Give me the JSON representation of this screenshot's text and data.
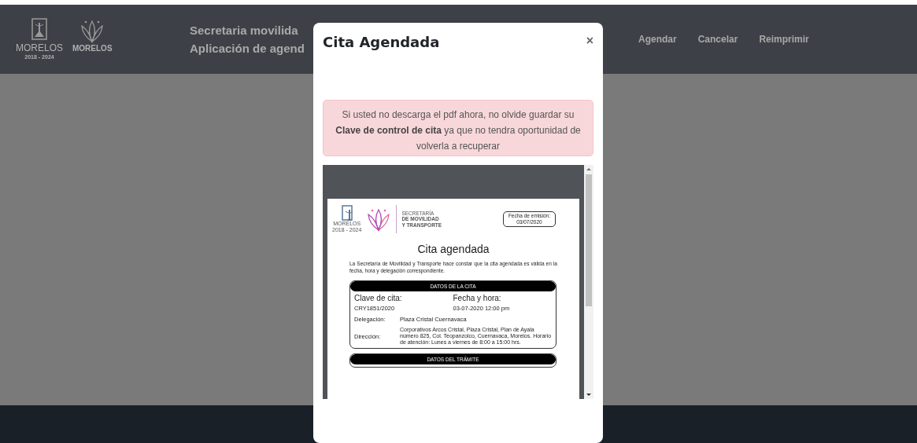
{
  "header": {
    "logo": {
      "name": "MORELOS",
      "years": "2018 - 2024"
    },
    "brand_logo": {
      "name": "MORELOS"
    },
    "title": "Secretaria movilida",
    "subtitle": "Aplicación de agend",
    "nav": [
      {
        "label": "Agendar"
      },
      {
        "label": "Cancelar"
      },
      {
        "label": "Reimprimir"
      }
    ]
  },
  "modal": {
    "title": "Cita Agendada",
    "close": "×",
    "alert": "Si usted no descarga el pdf ahora, no olvide guardar su **Clave de control de cita** ya que no tendra oportunidad de volverla a recuperar",
    "pdf": {
      "logo": {
        "name": "MORELOS",
        "years": "2018 - 2024"
      },
      "agency": [
        "SECRETARÍA",
        "DE MOVILIDAD",
        "Y TRANSPORTE"
      ],
      "issue_label": "Fecha de emisión:",
      "issue_date": "03/07/2020",
      "title": "Cita agendada",
      "intro": "La Secretaría de Movilidad y Transporte hace constar que la cita agendada es válida en la fecha, hora y delegación correspondiente.",
      "sections": [
        {
          "heading": "DATOS DE LA CITA",
          "fields": [
            {
              "kind": "column",
              "label": "Clave de cita:",
              "value": "CRY1851/2020"
            },
            {
              "kind": "column",
              "label": "Fecha y hora:",
              "value": "03-07-2020 12:00 pm"
            },
            {
              "kind": "row",
              "label": "Delegación:",
              "value": "Plaza Cristal Cuernavaca"
            },
            {
              "kind": "note",
              "label": "Dirección:",
              "value": "Corporativos Arcos Cristal, Plaza Cristal, Plan de Ayala número 825, Col. Teopanzolco, Cuernavaca, Morelos.  Horario de atención: Lunes a viernes de 8:00 a 15:00 hrs."
            }
          ]
        },
        {
          "heading": "DATOS DEL TRÁMITE"
        }
      ]
    }
  }
}
